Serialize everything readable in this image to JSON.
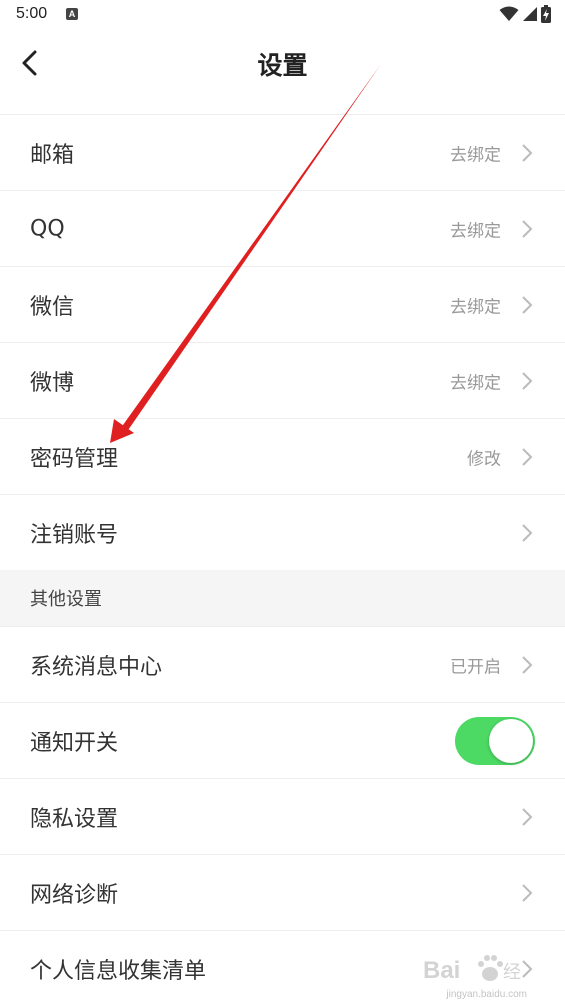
{
  "status_bar": {
    "time": "5:00",
    "notification_icon": "a-icon"
  },
  "header": {
    "title": "设置",
    "back_icon": "chevron-left-icon"
  },
  "rows_account": [
    {
      "label": "邮箱",
      "value": "去绑定"
    },
    {
      "label": "QQ",
      "value": "去绑定"
    },
    {
      "label": "微信",
      "value": "去绑定"
    },
    {
      "label": "微博",
      "value": "去绑定"
    },
    {
      "label": "密码管理",
      "value": "修改"
    },
    {
      "label": "注销账号",
      "value": ""
    }
  ],
  "section_other": {
    "title": "其他设置"
  },
  "rows_other": [
    {
      "label": "系统消息中心",
      "value": "已开启"
    },
    {
      "label": "通知开关",
      "toggle_on": true
    },
    {
      "label": "隐私设置",
      "value": ""
    },
    {
      "label": "网络诊断",
      "value": ""
    },
    {
      "label": "个人信息收集清单",
      "value": ""
    }
  ],
  "colors": {
    "toggle_on": "#4cd964",
    "annotation_arrow": "#e02020",
    "value_text": "#999999"
  },
  "watermark": {
    "text": "Baidu经验",
    "url": "jingyan.baidu.com"
  }
}
